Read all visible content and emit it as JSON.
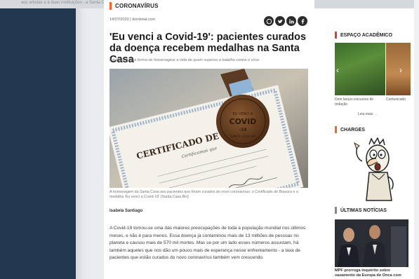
{
  "top_strip": {
    "text": "aos artistas e à duas instituições - a Santa C..."
  },
  "article": {
    "section_label": "CORONAVÍRUS",
    "meta": "14/07/2020 | domtotal.com",
    "share_icons": [
      "whatsapp-icon",
      "twitter-icon",
      "linkedin-icon",
      "facebook-icon"
    ],
    "title": "'Eu venci a Covid-19': pacientes curados da doença recebem medalhas na Santa Casa",
    "subtitle": "Iniciativa é uma forma de homenagear a vida de quem superou a batalha contra o vírus",
    "photo": {
      "certificate_title": "CERTIFICADO DE BRAVURA",
      "certificate_sub": "Certificamos que",
      "medal_text": "EU VENCI A COVID-19 SANTA CASA BH"
    },
    "caption": "A homenagem da Santa Casa aos pacientes que foram curados do novo coronavírus: o Certificado de Bravura e a medalha 'Eu venci a Covid-19' (Santa Casa BH)",
    "author": "Isabela Santiago",
    "body": "A Covid-19 tornou-se uma das maiores preocupações de toda a população mundial nos últimos meses, e não é para menos. Essa doença já contaminou mais de 13 milhões de pessoas no planeta e causou mais de 570 mil mortes. Mas se por um lado esses números assustam, há também aqueles que nos dão um pouco mais de esperança nesse enfrentamento - a taxa de pacientes que estão curados do novo coronavírus também vem crescendo."
  },
  "sidebar": {
    "academico": {
      "label": "ESPAÇO ACADÊMICO",
      "item1_caption": "Dom lança concursos de redação",
      "item2_caption": "Comunicado",
      "see_more": "Leia mais"
    },
    "charges": {
      "label": "CHARGES"
    },
    "ultimas": {
      "label": "ÚLTIMAS NOTÍCIAS",
      "news_caption": "MPF prorroga inquérito sobre vazamento da Europa do Onca com"
    }
  },
  "colors": {
    "accent_orange": "#f26522",
    "accent_red": "#e53935",
    "left_panel": "#243b55"
  }
}
